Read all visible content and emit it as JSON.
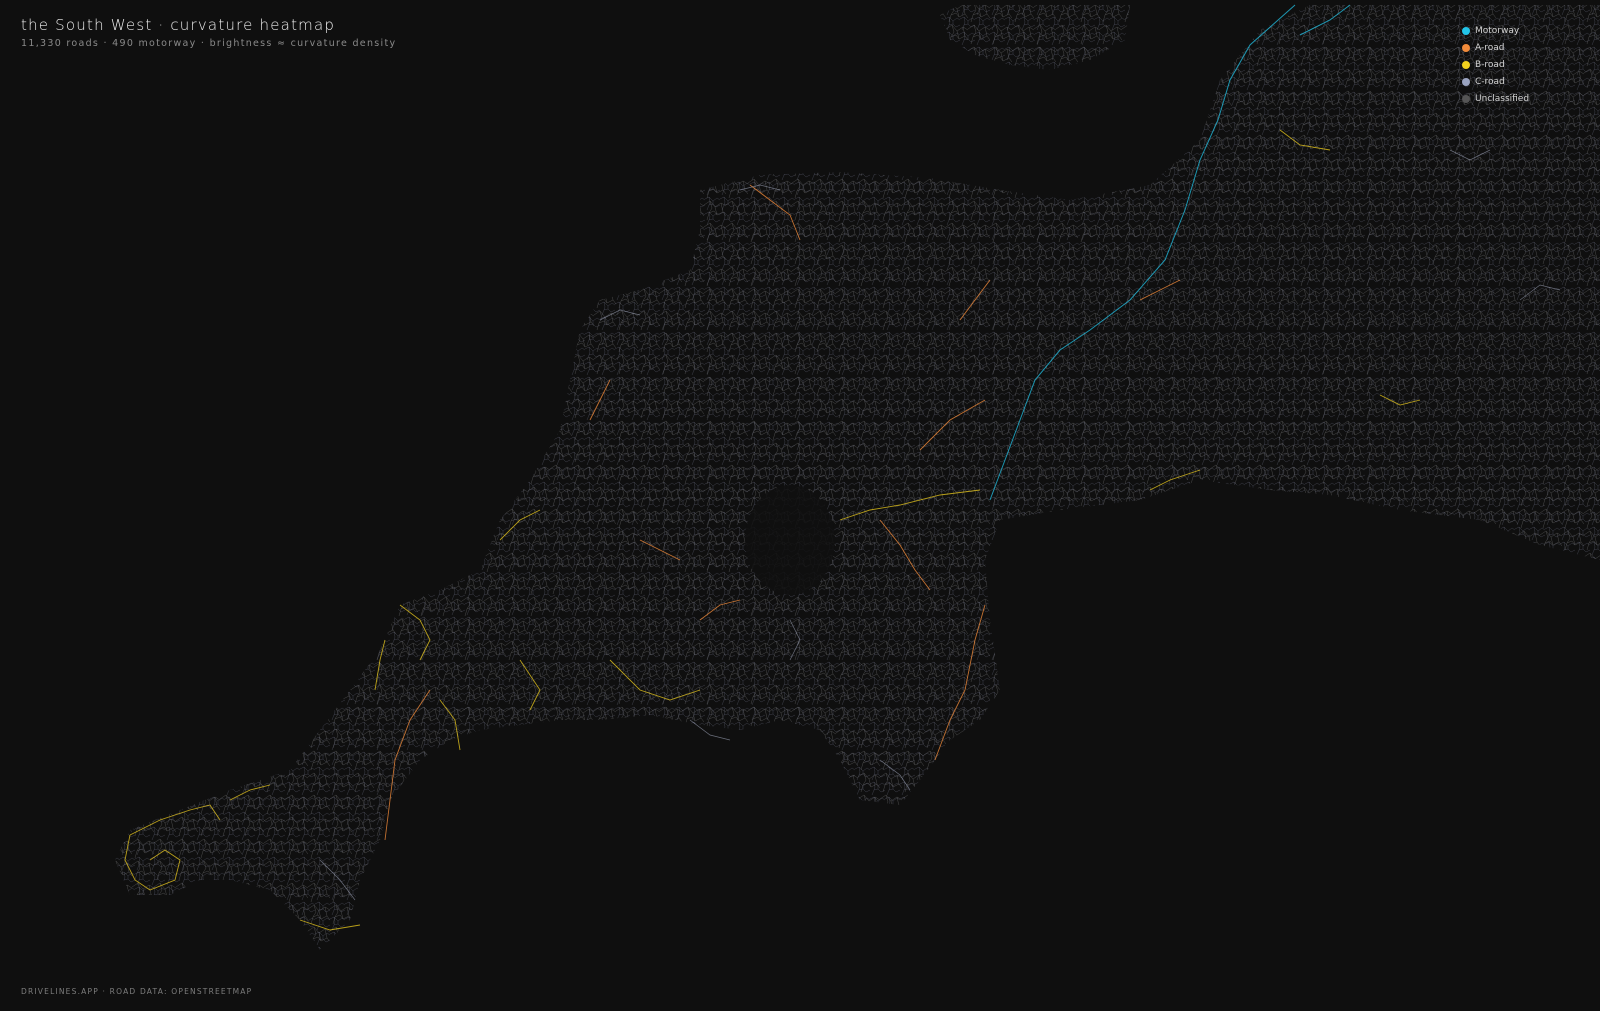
{
  "header": {
    "title": "the South West · curvature heatmap",
    "subtitle": "11,330 roads · 490 motorway · brightness ≈ curvature density"
  },
  "legend": {
    "items": [
      {
        "label": "Motorway",
        "color": "#22c4e8"
      },
      {
        "label": "A-road",
        "color": "#f08a3a"
      },
      {
        "label": "B-road",
        "color": "#f2d01e"
      },
      {
        "label": "C-road",
        "color": "#9aa3c0"
      },
      {
        "label": "Unclassified",
        "color": "#555555"
      }
    ]
  },
  "footer": {
    "credit": "DRIVELINES.APP · ROAD DATA: OPENSTREETMAP"
  },
  "colors": {
    "background": "#0f0f0f",
    "motorway": "#22c4e8",
    "a_road": "#f08a3a",
    "b_road": "#f2d01e",
    "c_road": "#9aa3c0",
    "unclassified": "#555555"
  }
}
